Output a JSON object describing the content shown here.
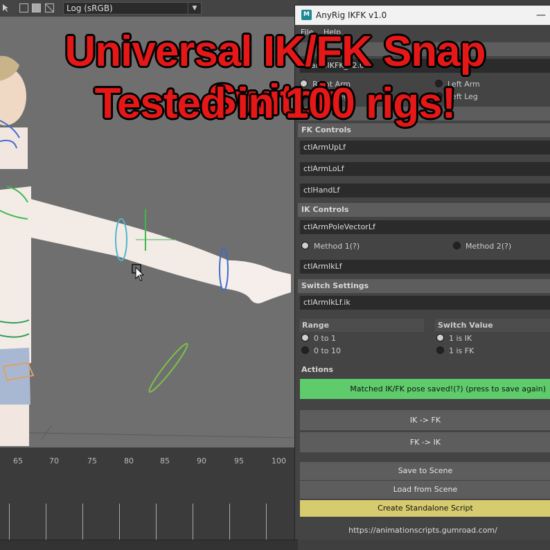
{
  "viewport": {
    "color_space": "Log (sRGB)",
    "timeline_labels": [
      "65",
      "70",
      "75",
      "80",
      "85",
      "90",
      "95",
      "100"
    ]
  },
  "overlay": {
    "line1": "Universal IK/FK Snap Switch",
    "line2": "Tested in 100 rigs!"
  },
  "window": {
    "icon_letter": "M",
    "title": "AnyRig IKFK v1.0",
    "minimize": "—",
    "menu": [
      "File",
      "Help"
    ],
    "namespace_field": "marcoIKFK_v2.0:",
    "limbs": [
      {
        "label": "Right Arm",
        "selected": true
      },
      {
        "label": "Right Leg",
        "selected": false
      },
      {
        "label": "Left Arm",
        "selected": false
      },
      {
        "label": "Left Leg",
        "selected": false
      }
    ],
    "fk_section": "FK Controls",
    "fk_controls": [
      "ctlArmUpLf",
      "ctlArmLoLf",
      "ctlHandLf"
    ],
    "ik_section": "IK Controls",
    "pole_vector": "ctlArmPoleVectorLf",
    "methods": [
      {
        "label": "Method 1(?)",
        "selected": true
      },
      {
        "label": "Method 2(?)",
        "selected": false
      }
    ],
    "ik_control": "ctlArmIkLf",
    "switch_section": "Switch Settings",
    "switch_attr": "ctlArmIkLf.ik",
    "range_header": "Range",
    "range_options": [
      {
        "label": "0 to 1",
        "selected": true
      },
      {
        "label": "0 to 10",
        "selected": false
      }
    ],
    "value_header": "Switch Value",
    "value_options": [
      {
        "label": "1 is IK",
        "selected": true
      },
      {
        "label": "1 is FK",
        "selected": false
      }
    ],
    "actions_section": "Actions",
    "saved_button": "Matched IK/FK pose saved!(?) (press to save again)",
    "ik_to_fk": "IK -> FK",
    "fk_to_ik": "FK -> IK",
    "save_scene": "Save to Scene",
    "load_scene": "Load from Scene",
    "create_script": "Create Standalone Script",
    "footer_link": "https://animationscripts.gumroad.com/"
  },
  "colors": {
    "saved_green": "#5fcc6c",
    "script_yellow": "#d6cb6f",
    "banner_red": "#e51717"
  }
}
